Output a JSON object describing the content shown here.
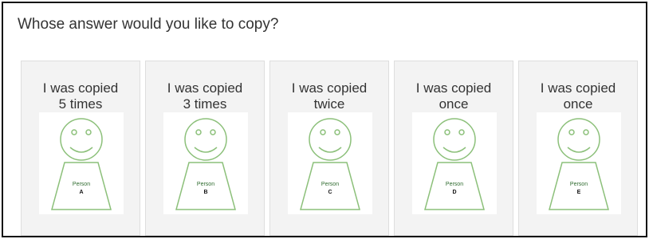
{
  "question": "Whose answer would you like to copy?",
  "colors": {
    "figure_stroke": "#8cc07a",
    "card_bg": "#f3f3f3"
  },
  "cards": [
    {
      "caption_line1": "I was copied",
      "caption_line2": "5 times",
      "person_label": "Person",
      "person_letter": "A"
    },
    {
      "caption_line1": "I was copied",
      "caption_line2": "3 times",
      "person_label": "Person",
      "person_letter": "B"
    },
    {
      "caption_line1": "I was copied",
      "caption_line2": "twice",
      "person_label": "Person",
      "person_letter": "C"
    },
    {
      "caption_line1": "I was copied",
      "caption_line2": "once",
      "person_label": "Person",
      "person_letter": "D"
    },
    {
      "caption_line1": "I was copied",
      "caption_line2": "once",
      "person_label": "Person",
      "person_letter": "E"
    }
  ]
}
